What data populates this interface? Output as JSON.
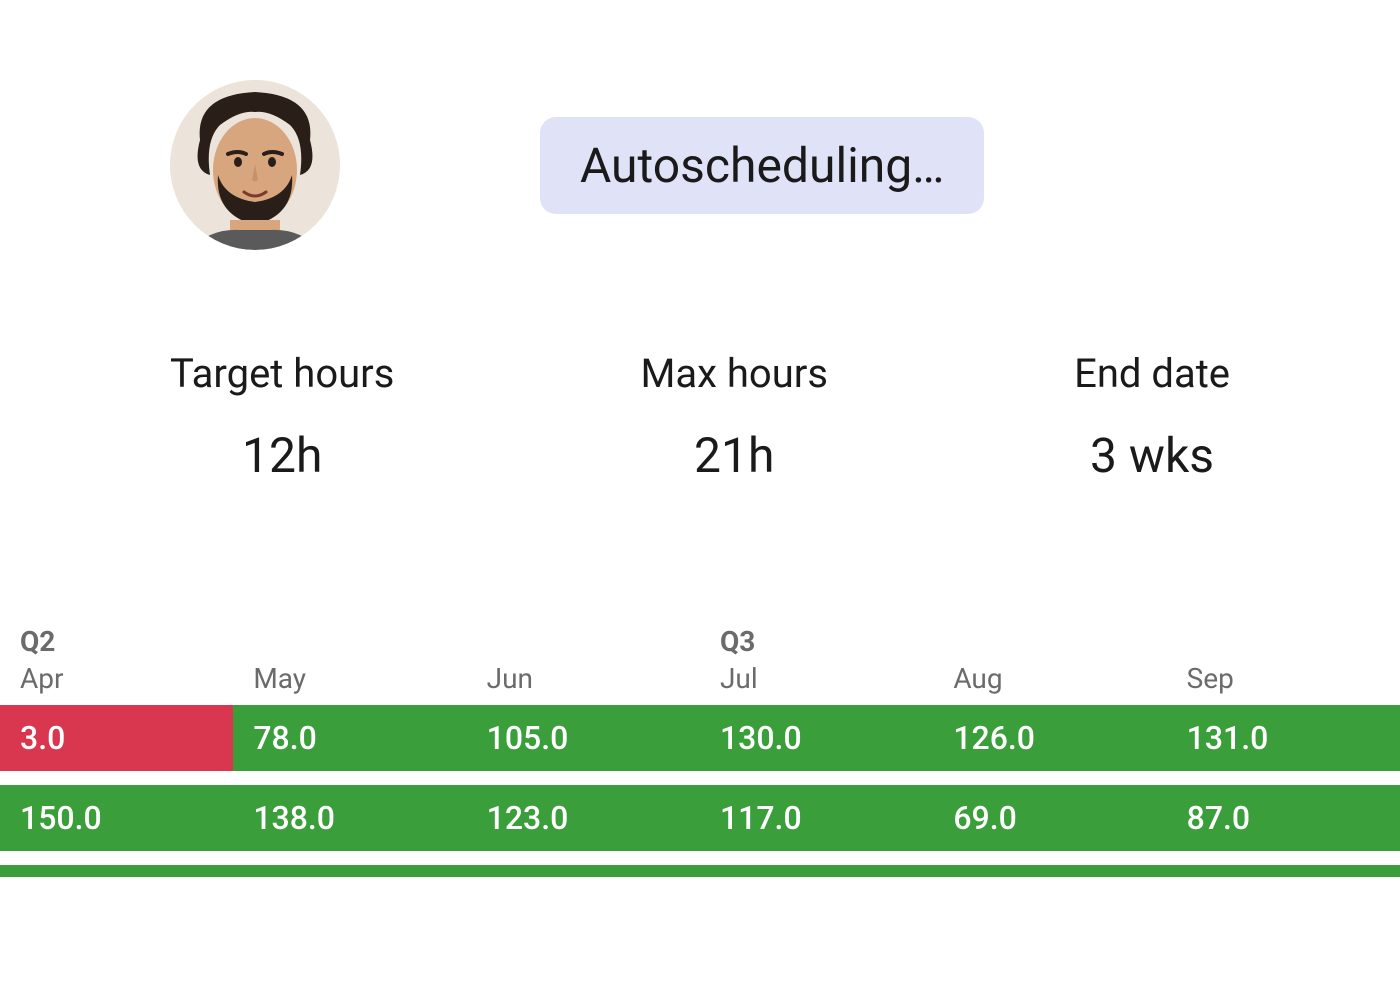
{
  "status": {
    "label": "Autoscheduling…"
  },
  "stats": {
    "target_hours": {
      "label": "Target hours",
      "value": "12h"
    },
    "max_hours": {
      "label": "Max hours",
      "value": "21h"
    },
    "end_date": {
      "label": "End date",
      "value": "3 wks"
    }
  },
  "timeline": {
    "months": [
      {
        "quarter": "Q2",
        "label": "Apr"
      },
      {
        "quarter": "",
        "label": "May"
      },
      {
        "quarter": "",
        "label": "Jun"
      },
      {
        "quarter": "Q3",
        "label": "Jul"
      },
      {
        "quarter": "",
        "label": "Aug"
      },
      {
        "quarter": "",
        "label": "Sep"
      }
    ],
    "rows": [
      [
        {
          "value": "3.0",
          "status": "red"
        },
        {
          "value": "78.0",
          "status": "green"
        },
        {
          "value": "105.0",
          "status": "green"
        },
        {
          "value": "130.0",
          "status": "green"
        },
        {
          "value": "126.0",
          "status": "green"
        },
        {
          "value": "131.0",
          "status": "green"
        }
      ],
      [
        {
          "value": "150.0",
          "status": "green"
        },
        {
          "value": "138.0",
          "status": "green"
        },
        {
          "value": "123.0",
          "status": "green"
        },
        {
          "value": "117.0",
          "status": "green"
        },
        {
          "value": "69.0",
          "status": "green"
        },
        {
          "value": "87.0",
          "status": "green"
        }
      ]
    ]
  },
  "colors": {
    "green": "#3a9e3a",
    "red": "#d9374f",
    "pill_bg": "#e0e3f8"
  }
}
